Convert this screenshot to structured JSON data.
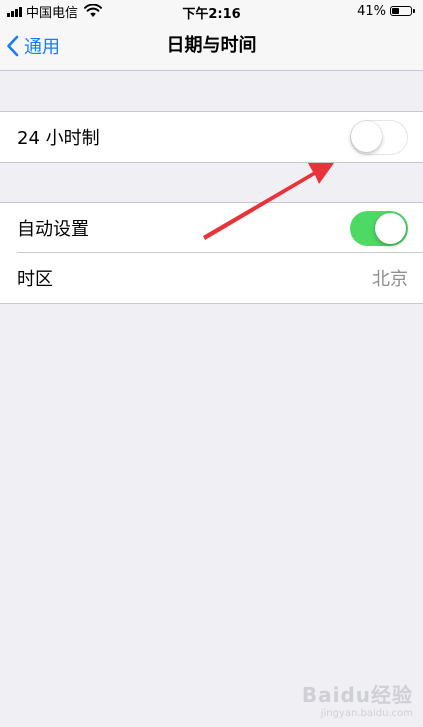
{
  "status_bar": {
    "carrier": "中国电信",
    "time": "下午2:16",
    "battery_percent": "41%",
    "battery_level": 0.41,
    "signal_icon": "signal-bars-icon",
    "wifi_icon": "wifi-icon",
    "battery_icon": "battery-icon"
  },
  "nav_bar": {
    "back_label": "通用",
    "back_icon": "chevron-left-icon",
    "title": "日期与时间"
  },
  "settings": {
    "hour24": {
      "label": "24 小时制",
      "enabled": false
    },
    "auto_set": {
      "label": "自动设置",
      "enabled": true
    },
    "timezone": {
      "label": "时区",
      "value": "北京"
    }
  },
  "annotation": {
    "icon": "red-arrow-icon",
    "color": "#e8333a"
  },
  "watermark": {
    "main": "Baidu经验",
    "sub": "jingyan.baidu.com"
  },
  "colors": {
    "accent": "#1a7cf5",
    "toggle_on": "#4cd964",
    "background": "#efeff4"
  }
}
